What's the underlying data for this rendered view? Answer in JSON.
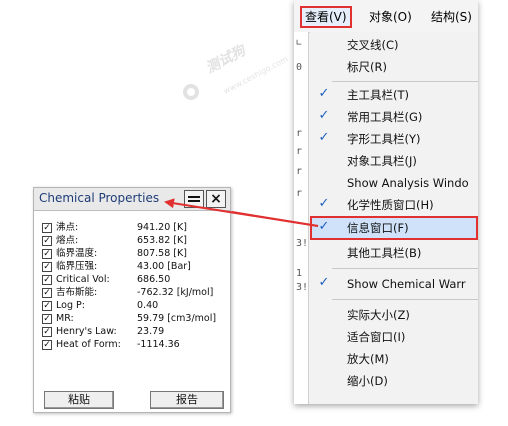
{
  "menubar": {
    "items": [
      {
        "label": "查看(V)",
        "active": true
      },
      {
        "label": "对象(O)",
        "active": false
      },
      {
        "label": "结构(S)",
        "active": false
      }
    ]
  },
  "view_menu": {
    "items": [
      {
        "label": "交叉线(C)",
        "checked": false,
        "highlighted": false
      },
      {
        "label": "标尺(R)",
        "checked": false,
        "highlighted": false
      },
      {
        "label": "主工具栏(T)",
        "checked": true,
        "highlighted": false
      },
      {
        "label": "常用工具栏(G)",
        "checked": true,
        "highlighted": false
      },
      {
        "label": "字形工具栏(Y)",
        "checked": true,
        "highlighted": false
      },
      {
        "label": "对象工具栏(J)",
        "checked": false,
        "highlighted": false
      },
      {
        "label": "Show Analysis Windo",
        "checked": false,
        "highlighted": false
      },
      {
        "label": "化学性质窗口(H)",
        "checked": true,
        "highlighted": false
      },
      {
        "label": "信息窗口(F)",
        "checked": true,
        "highlighted": true
      },
      {
        "label": "其他工具栏(B)",
        "checked": false,
        "highlighted": false
      },
      {
        "label": "Show Chemical Warr",
        "checked": true,
        "highlighted": false
      },
      {
        "label": "实际大小(Z)",
        "checked": false,
        "highlighted": false
      },
      {
        "label": "适合窗口(I)",
        "checked": false,
        "highlighted": false
      },
      {
        "label": "放大(M)",
        "checked": false,
        "highlighted": false
      },
      {
        "label": "缩小(D)",
        "checked": false,
        "highlighted": false
      }
    ]
  },
  "left_strip_glyphs": [
    "∟",
    "0",
    "r",
    "r",
    "r",
    "r",
    "3!",
    "1",
    "3!"
  ],
  "chem_panel": {
    "title": "Chemical Properties",
    "min_symbol": "—",
    "close_symbol": "×",
    "properties": [
      {
        "name": "沸点:",
        "value": "941.20 [K]",
        "checked": true
      },
      {
        "name": "熔点:",
        "value": "653.82 [K]",
        "checked": true
      },
      {
        "name": "临界温度:",
        "value": "807.58 [K]",
        "checked": true
      },
      {
        "name": "临界压强:",
        "value": "43.00 [Bar]",
        "checked": true
      },
      {
        "name": "Critical Vol:",
        "value": "686.50",
        "checked": true
      },
      {
        "name": "吉布斯能:",
        "value": "-762.32 [kJ/mol]",
        "checked": true
      },
      {
        "name": "Log P:",
        "value": "0.40",
        "checked": true
      },
      {
        "name": "MR:",
        "value": "59.79 [cm3/mol]",
        "checked": true
      },
      {
        "name": "Henry's Law:",
        "value": "23.79",
        "checked": true
      },
      {
        "name": "Heat of Form:",
        "value": "-1114.36",
        "checked": true
      }
    ],
    "paste_button": "粘贴",
    "report_button": "报告"
  },
  "watermark": {
    "text": "测试狗",
    "url": "www.ceshigo.com"
  },
  "colors": {
    "highlight_border": "#e03030",
    "highlight_fill": "#cfe2f9",
    "check": "#1d5fbf",
    "arrow": "#e03030"
  }
}
